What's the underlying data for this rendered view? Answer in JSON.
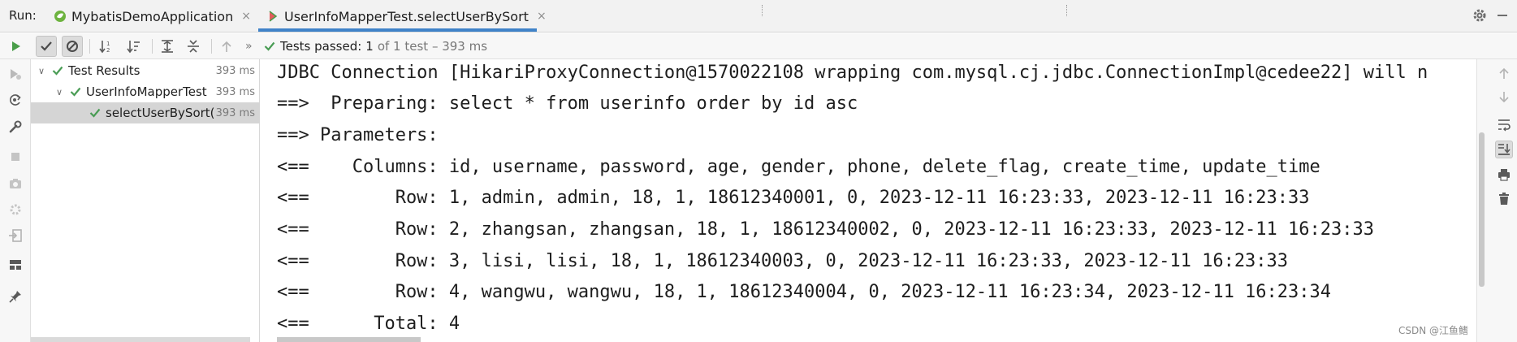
{
  "topbar": {
    "run_label": "Run:",
    "tabs": [
      {
        "label": "MybatisDemoApplication",
        "close": "×"
      },
      {
        "label": "UserInfoMapperTest.selectUserBySort",
        "close": "×"
      }
    ]
  },
  "toolbar": {
    "status_prefix": "Tests passed:",
    "status_count": "1",
    "status_rest": "of 1 test – 393 ms",
    "overflow": "»"
  },
  "tree": {
    "items": [
      {
        "label": "Test Results",
        "time": "393 ms",
        "arrow": "∨"
      },
      {
        "label": "UserInfoMapperTest",
        "time": "393 ms",
        "arrow": "∨"
      },
      {
        "label": "selectUserBySort(",
        "time": "393 ms",
        "arrow": ""
      }
    ]
  },
  "console": {
    "lines": [
      "JDBC Connection [HikariProxyConnection@1570022108 wrapping com.mysql.cj.jdbc.ConnectionImpl@cedee22] will n",
      "==>  Preparing: select * from userinfo order by id asc",
      "==> Parameters: ",
      "<==    Columns: id, username, password, age, gender, phone, delete_flag, create_time, update_time",
      "<==        Row: 1, admin, admin, 18, 1, 18612340001, 0, 2023-12-11 16:23:33, 2023-12-11 16:23:33",
      "<==        Row: 2, zhangsan, zhangsan, 18, 1, 18612340002, 0, 2023-12-11 16:23:33, 2023-12-11 16:23:33",
      "<==        Row: 3, lisi, lisi, 18, 1, 18612340003, 0, 2023-12-11 16:23:33, 2023-12-11 16:23:33",
      "<==        Row: 4, wangwu, wangwu, 18, 1, 18612340004, 0, 2023-12-11 16:23:34, 2023-12-11 16:23:34",
      "<==      Total: 4"
    ]
  },
  "watermark": "CSDN @江鱼鳍",
  "colors": {
    "pass_green": "#499c54",
    "run_green": "#4a9e4a",
    "accent_blue": "#4083c9"
  }
}
